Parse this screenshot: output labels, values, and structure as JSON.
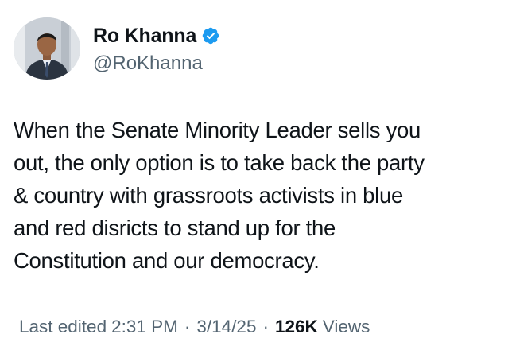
{
  "author": {
    "display_name": "Ro Khanna",
    "handle": "@RoKhanna",
    "verified": true,
    "verified_color": "#1d9bf0"
  },
  "tweet": {
    "text": "When the Senate Minority Leader sells you\nout, the only option is to take back the party\n& country with grassroots activists in blue\nand red disricts to stand up for the\nConstitution and our democracy."
  },
  "meta": {
    "edited_label": "Last edited",
    "time": "2:31 PM",
    "date": "3/14/25",
    "separator": "·",
    "views_count": "126K",
    "views_label": "Views"
  },
  "icons": {
    "verified": "verified-badge-icon",
    "avatar": "profile-avatar"
  }
}
